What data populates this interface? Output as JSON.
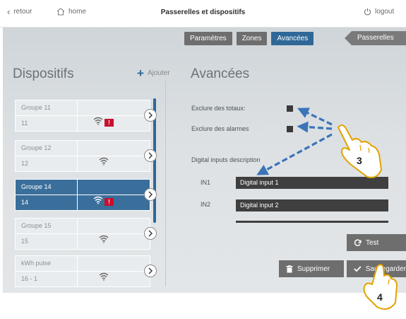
{
  "topbar": {
    "back_label": "retour",
    "home_label": "home",
    "title": "Passerelles et dispositifs",
    "logout_label": "logout"
  },
  "tabs": [
    "Paramètres",
    "Zones",
    "Avancées"
  ],
  "active_tab": 2,
  "gateway_tab": "Passerelles",
  "devices": {
    "title": "Dispositifs",
    "add_label": "Ajouter",
    "items": [
      {
        "name": "Groupe 11",
        "id": "11",
        "alert": "!",
        "selected": false
      },
      {
        "name": "Groupe 12",
        "id": "12",
        "selected": false
      },
      {
        "name": "Groupe 14",
        "id": "14",
        "alert": "!",
        "selected": true
      },
      {
        "name": "Groupe 15",
        "id": "15",
        "selected": false
      },
      {
        "name": "kWh pulse",
        "id": "16 - 1",
        "selected": false
      }
    ]
  },
  "advanced": {
    "title": "Avancées",
    "exclude_totals": "Exclure des totaux:",
    "exclude_alarms": "Exclure des alarmes",
    "digital_inputs_title": "Digital inputs description",
    "inputs": [
      {
        "label": "IN1",
        "value": "Digital input 1"
      },
      {
        "label": "IN2",
        "value": "Digital input 2"
      }
    ]
  },
  "actions": {
    "test": "Test",
    "delete": "Supprimer",
    "save": "Sauvegarder"
  },
  "annotations": {
    "step3": "3",
    "step4": "4"
  },
  "colors": {
    "accent": "#2f6897",
    "alert": "#c8102e",
    "arrow": "#3b74b8"
  }
}
